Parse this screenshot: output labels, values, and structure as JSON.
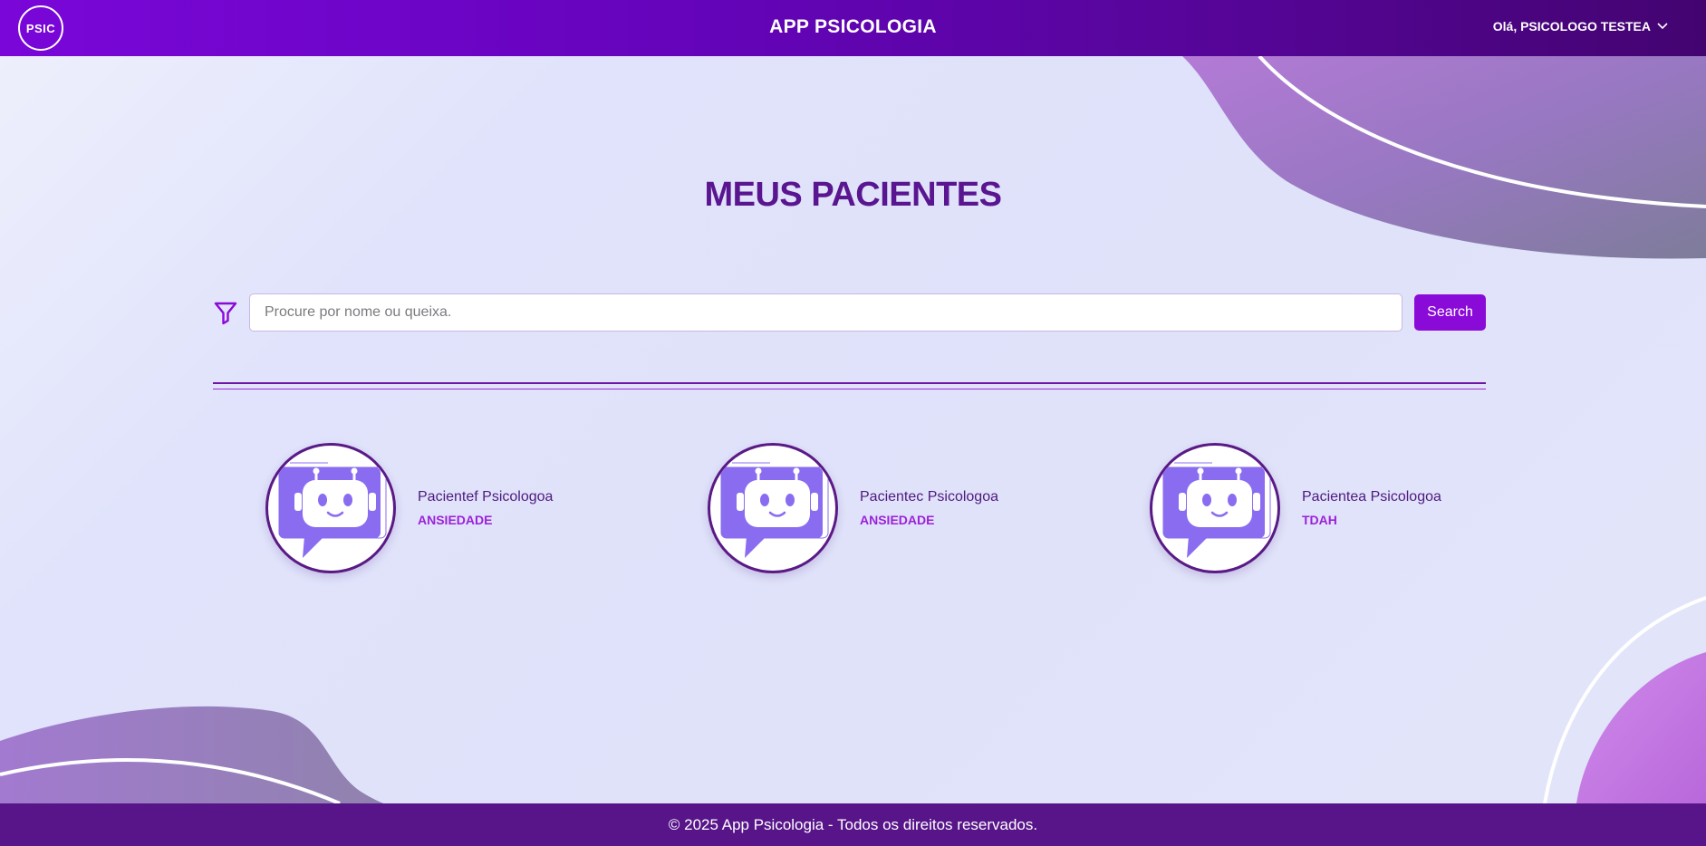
{
  "header": {
    "logo_text": "PSIC",
    "app_title": "APP PSICOLOGIA",
    "user_greeting": "Olá, PSICOLOGO TESTEA",
    "user_menu_icon": "chevron-down-icon"
  },
  "main": {
    "title": "MEUS PACIENTES",
    "filter_icon": "filter-icon",
    "search": {
      "placeholder": "Procure por nome ou queixa.",
      "value": "",
      "button_label": "Search"
    },
    "patients": [
      {
        "name": "Pacientef Psicologoa",
        "complaint": "ANSIEDADE",
        "avatar_icon": "robot-chat-icon"
      },
      {
        "name": "Pacientec Psicologoa",
        "complaint": "ANSIEDADE",
        "avatar_icon": "robot-chat-icon"
      },
      {
        "name": "Pacientea Psicologoa",
        "complaint": "TDAH",
        "avatar_icon": "robot-chat-icon"
      }
    ]
  },
  "footer": {
    "copyright": "© 2025 App Psicologia - Todos os direitos reservados."
  },
  "colors": {
    "header_start": "#7a06d9",
    "header_end": "#430470",
    "title": "#5a1590",
    "accent": "#8a0ad8",
    "footer": "#571589",
    "avatar_bot": "#8a6cf0"
  }
}
